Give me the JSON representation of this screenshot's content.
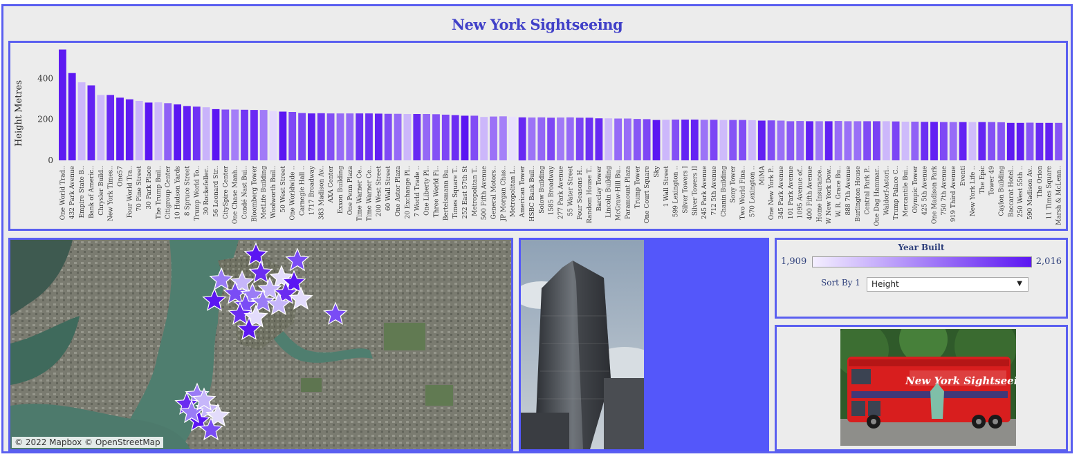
{
  "title": "New York Sightseeing",
  "chart_data": {
    "type": "bar",
    "ylabel": "Height Metres",
    "yticks": [
      0,
      200,
      400
    ],
    "ylim": [
      0,
      560
    ],
    "color_scale": {
      "min_year": 1909,
      "max_year": 2016,
      "min_color": "#e9e1fd",
      "max_color": "#5b16f2"
    },
    "bars": [
      {
        "name": "One World Trad..",
        "height": 541,
        "year": 2014
      },
      {
        "name": "432 Park Avenue",
        "height": 426,
        "year": 2015
      },
      {
        "name": "Empire State B..",
        "height": 381,
        "year": 1931
      },
      {
        "name": "Bank of Americ..",
        "height": 366,
        "year": 2009
      },
      {
        "name": "Chrysler Build..",
        "height": 319,
        "year": 1930
      },
      {
        "name": "New York Times..",
        "height": 319,
        "year": 2007
      },
      {
        "name": "One57",
        "height": 306,
        "year": 2014
      },
      {
        "name": "Four World Tra..",
        "height": 298,
        "year": 2013
      },
      {
        "name": "70 Pine Street",
        "height": 290,
        "year": 1932
      },
      {
        "name": "30 Park Place",
        "height": 282,
        "year": 2016
      },
      {
        "name": "The Trump Buil..",
        "height": 283,
        "year": 1930
      },
      {
        "name": "Citigroup Center",
        "height": 279,
        "year": 1977
      },
      {
        "name": "10 Hudson Yards",
        "height": 273,
        "year": 2016
      },
      {
        "name": "8 Spruce Street",
        "height": 265,
        "year": 2011
      },
      {
        "name": "Trump World To..",
        "height": 262,
        "year": 2001
      },
      {
        "name": "30 Rockefeller..",
        "height": 259,
        "year": 1933
      },
      {
        "name": "56 Leonard Str..",
        "height": 250,
        "year": 2016
      },
      {
        "name": "CitySpire Center",
        "height": 248,
        "year": 1987
      },
      {
        "name": "One Chase Manh..",
        "height": 248,
        "year": 1961
      },
      {
        "name": "Condé Nast Bui..",
        "height": 247,
        "year": 1999
      },
      {
        "name": "Bloomberg Tower",
        "height": 246,
        "year": 2005
      },
      {
        "name": "MetLife Building",
        "height": 246,
        "year": 1963
      },
      {
        "name": "Woolworth Buil..",
        "height": 241,
        "year": 1913
      },
      {
        "name": "50 West Street",
        "height": 238,
        "year": 2016
      },
      {
        "name": "One Worldwide ..",
        "height": 236,
        "year": 1989
      },
      {
        "name": "Carnegie Hall ..",
        "height": 231,
        "year": 1991
      },
      {
        "name": "1717 Broadway",
        "height": 229,
        "year": 2013
      },
      {
        "name": "383 Madison Av..",
        "height": 230,
        "year": 2001
      },
      {
        "name": "AXA Center",
        "height": 229,
        "year": 1986
      },
      {
        "name": "Exxon Building",
        "height": 229,
        "year": 1971
      },
      {
        "name": "One Penn Plaza",
        "height": 229,
        "year": 1972
      },
      {
        "name": "Time Warner Ce..",
        "height": 229,
        "year": 2003
      },
      {
        "name": "Time Warner Ce..",
        "height": 229,
        "year": 2003
      },
      {
        "name": "200 West Street",
        "height": 228,
        "year": 2010
      },
      {
        "name": "60 Wall Street",
        "height": 227,
        "year": 1989
      },
      {
        "name": "One Astor Plaza",
        "height": 227,
        "year": 1972
      },
      {
        "name": "20 Exchange Pl..",
        "height": 226,
        "year": 1931
      },
      {
        "name": "7 World Trade ..",
        "height": 226,
        "year": 2006
      },
      {
        "name": "One Liberty Pl..",
        "height": 226,
        "year": 1973
      },
      {
        "name": "Three World Fi..",
        "height": 225,
        "year": 1985
      },
      {
        "name": "Bertelsmann Bu..",
        "height": 223,
        "year": 1990
      },
      {
        "name": "Times Square T..",
        "height": 221,
        "year": 2004
      },
      {
        "name": "252 East 57th St",
        "height": 218,
        "year": 2016
      },
      {
        "name": "Metropolitan T..",
        "height": 218,
        "year": 1987
      },
      {
        "name": "500 Fifth Avenue",
        "height": 212,
        "year": 1931
      },
      {
        "name": "General Motors..",
        "height": 214,
        "year": 1968
      },
      {
        "name": "JP Morgan Chas..",
        "height": 215,
        "year": 1960
      },
      {
        "name": "Metropolitan L..",
        "height": 213,
        "year": 1909
      },
      {
        "name": "American Tower",
        "height": 210,
        "year": 2006
      },
      {
        "name": "HSBC Bank Buil..",
        "height": 209,
        "year": 1967
      },
      {
        "name": "Solow Building",
        "height": 210,
        "year": 1974
      },
      {
        "name": "1585 Broadway",
        "height": 208,
        "year": 1990
      },
      {
        "name": "277 Park Avenue",
        "height": 209,
        "year": 1964
      },
      {
        "name": "55 Water Street",
        "height": 210,
        "year": 1972
      },
      {
        "name": "Four Seasons H..",
        "height": 208,
        "year": 1993
      },
      {
        "name": "Random House T..",
        "height": 208,
        "year": 2003
      },
      {
        "name": "Barclay Tower",
        "height": 205,
        "year": 2007
      },
      {
        "name": "Lincoln Building",
        "height": 205,
        "year": 1930
      },
      {
        "name": "McGraw-Hill Bu..",
        "height": 204,
        "year": 1972
      },
      {
        "name": "Paramount Plaza",
        "height": 204,
        "year": 1970
      },
      {
        "name": "Trump Tower",
        "height": 202,
        "year": 1983
      },
      {
        "name": "One Court Square",
        "height": 201,
        "year": 1990
      },
      {
        "name": "Sky",
        "height": 197,
        "year": 2016
      },
      {
        "name": "1 Wall Street",
        "height": 198,
        "year": 1931
      },
      {
        "name": "599 Lexington ..",
        "height": 199,
        "year": 1986
      },
      {
        "name": "Silver Towers I",
        "height": 199,
        "year": 2009
      },
      {
        "name": "Silver Towers II",
        "height": 199,
        "year": 2009
      },
      {
        "name": "245 Park Avenue",
        "height": 198,
        "year": 1967
      },
      {
        "name": "712 5th Avenue",
        "height": 198,
        "year": 1991
      },
      {
        "name": "Chanin Building",
        "height": 197,
        "year": 1929
      },
      {
        "name": "Sony Tower",
        "height": 197,
        "year": 1984
      },
      {
        "name": "Two World Fina..",
        "height": 197,
        "year": 1987
      },
      {
        "name": "570 Lexington ..",
        "height": 196,
        "year": 1931
      },
      {
        "name": "MiMA",
        "height": 194,
        "year": 2011
      },
      {
        "name": "One New York P..",
        "height": 195,
        "year": 1987
      },
      {
        "name": "345 Park Avenue",
        "height": 194,
        "year": 1969
      },
      {
        "name": "101 Park Avenue",
        "height": 191,
        "year": 1982
      },
      {
        "name": "1095 Avenue of..",
        "height": 192,
        "year": 1974
      },
      {
        "name": "400 Fifth Avenue",
        "height": 191,
        "year": 2010
      },
      {
        "name": "Home Insurance..",
        "height": 191,
        "year": 1966
      },
      {
        "name": "W New York Dow..",
        "height": 191,
        "year": 2010
      },
      {
        "name": "W. R. Grace Bu..",
        "height": 192,
        "year": 1971
      },
      {
        "name": "888 7th Avenue",
        "height": 191,
        "year": 1969
      },
      {
        "name": "Burlington House",
        "height": 191,
        "year": 1969
      },
      {
        "name": "Central Park P..",
        "height": 191,
        "year": 1988
      },
      {
        "name": "One Dag Hammar..",
        "height": 191,
        "year": 1993
      },
      {
        "name": "Waldorf-Astori..",
        "height": 191,
        "year": 1931
      },
      {
        "name": "Trump Palace C..",
        "height": 190,
        "year": 1991
      },
      {
        "name": "Mercantile Bui..",
        "height": 189,
        "year": 1929
      },
      {
        "name": "Olympic Tower",
        "height": 189,
        "year": 1976
      },
      {
        "name": "425 5th Avenue",
        "height": 188,
        "year": 2003
      },
      {
        "name": "One Madison Park",
        "height": 188,
        "year": 2010
      },
      {
        "name": "750 7th Avenue",
        "height": 187,
        "year": 1989
      },
      {
        "name": "919 Third Avenue",
        "height": 187,
        "year": 1971
      },
      {
        "name": "Eventi",
        "height": 187,
        "year": 2010
      },
      {
        "name": "New York Life ..",
        "height": 187,
        "year": 1928
      },
      {
        "name": "The Epic",
        "height": 187,
        "year": 2008
      },
      {
        "name": "Tower 49",
        "height": 187,
        "year": 1985
      },
      {
        "name": "Caylon Building",
        "height": 186,
        "year": 1983
      },
      {
        "name": "Baccarat Hotel..",
        "height": 183,
        "year": 2014
      },
      {
        "name": "250 West 55th ..",
        "height": 183,
        "year": 2013
      },
      {
        "name": "590 Madison Av..",
        "height": 184,
        "year": 1983
      },
      {
        "name": "The Orion",
        "height": 183,
        "year": 2006
      },
      {
        "name": "11 Times Square",
        "height": 183,
        "year": 2010
      },
      {
        "name": "Marsh & McLenn..",
        "height": 183,
        "year": 1984
      }
    ]
  },
  "map": {
    "attribution": "© 2022 Mapbox  © OpenStreetMap",
    "marker_color": "#6a2cf0"
  },
  "legend": {
    "title": "Year Built",
    "min_label": "1,909",
    "max_label": "2,016"
  },
  "sort": {
    "label": "Sort By 1",
    "selected": "Height"
  },
  "bus": {
    "banner_text": "New York Sightseeing"
  }
}
